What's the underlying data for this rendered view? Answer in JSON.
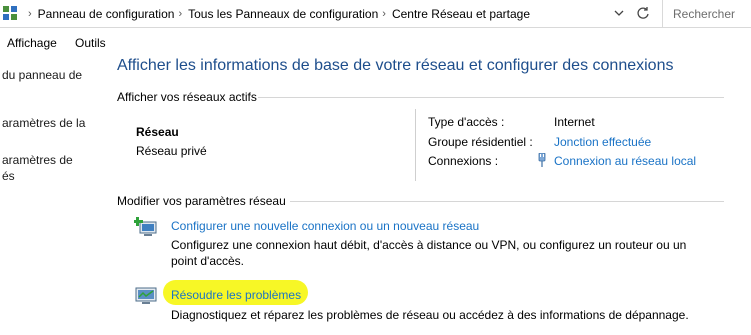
{
  "address_bar": {
    "breadcrumbs": [
      "Panneau de configuration",
      "Tous les Panneaux de configuration",
      "Centre Réseau et partage"
    ],
    "search_placeholder": "Rechercher"
  },
  "menu": {
    "affichage": "Affichage",
    "outils": "Outils"
  },
  "left_pane": {
    "items": [
      "du panneau de",
      "aramètres de la",
      "aramètres de",
      "és"
    ]
  },
  "main": {
    "title": "Afficher les informations de base de votre réseau et configurer des connexions",
    "active_networks_heading": "Afficher vos réseaux actifs",
    "network": {
      "name": "Réseau",
      "type": "Réseau privé"
    },
    "details": {
      "access_type_label": "Type d'accès :",
      "access_type_value": "Internet",
      "homegroup_label": "Groupe résidentiel :",
      "homegroup_value": "Jonction effectuée",
      "connections_label": "Connexions :",
      "connections_value": "Connexion au réseau local"
    },
    "modify_heading": "Modifier vos paramètres réseau",
    "tasks": [
      {
        "link": "Configurer une nouvelle connexion ou un nouveau réseau",
        "description": "Configurez une connexion haut débit, d'accès à distance ou VPN, ou configurez un routeur ou un point d'accès."
      },
      {
        "link": "Résoudre les problèmes",
        "description": "Diagnostiquez et réparez les problèmes de réseau ou accédez à des informations de dépannage."
      }
    ]
  },
  "colors": {
    "title": "#1e4e8c",
    "link": "#1a73c6",
    "highlight": "#f6f600"
  },
  "icons": [
    "control-panel-icon",
    "chevron-down-icon",
    "refresh-icon",
    "network-plug-icon",
    "new-connection-icon",
    "troubleshoot-icon"
  ]
}
